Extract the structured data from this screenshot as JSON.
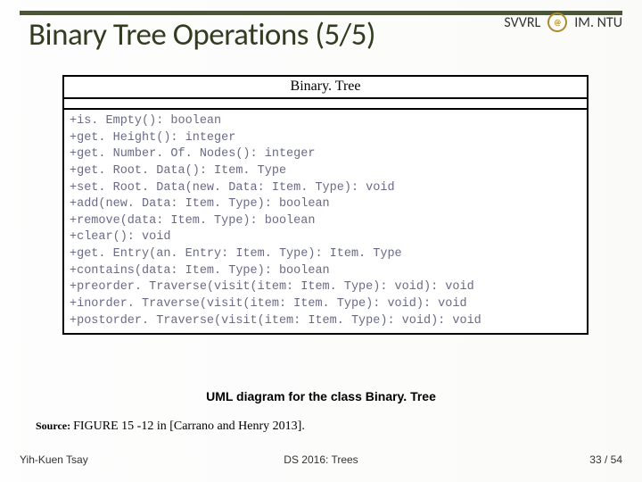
{
  "header": {
    "title": "Binary Tree Operations (5/5)",
    "org_left": "SVVRL",
    "org_right": "IM. NTU",
    "logo_text": "@"
  },
  "uml": {
    "class_name": "Binary. Tree",
    "operations": [
      "+is. Empty(): boolean",
      "+get. Height(): integer",
      "+get. Number. Of. Nodes(): integer",
      "+get. Root. Data(): Item. Type",
      "+set. Root. Data(new. Data: Item. Type): void",
      "+add(new. Data: Item. Type): boolean",
      "+remove(data: Item. Type): boolean",
      "+clear(): void",
      "+get. Entry(an. Entry: Item. Type): Item. Type",
      "+contains(data: Item. Type): boolean",
      "+preorder. Traverse(visit(item: Item. Type): void): void",
      "+inorder. Traverse(visit(item: Item. Type): void): void",
      "+postorder. Traverse(visit(item: Item. Type): void): void"
    ]
  },
  "caption": "UML diagram for the class Binary. Tree",
  "source": {
    "label": "Source: ",
    "text": "FIGURE 15 -12 in [Carrano and Henry 2013]."
  },
  "footer": {
    "author": "Yih-Kuen Tsay",
    "course": "DS 2016: Trees",
    "page_current": "33",
    "page_sep": " / ",
    "page_total": "54"
  }
}
